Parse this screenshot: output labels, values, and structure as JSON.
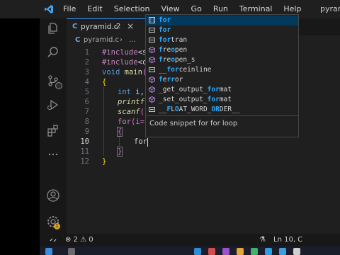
{
  "menu": [
    "File",
    "Edit",
    "Selection",
    "View",
    "Go",
    "Run",
    "Terminal",
    "Help"
  ],
  "window_title": "pyram",
  "tab": {
    "icon_letter": "C",
    "name": "pyramid.c",
    "problems": "2",
    "close": "×"
  },
  "breadcrumb": {
    "icon_letter": "C",
    "file": "pyramid.c",
    "separator": "›",
    "ellipsis": "..."
  },
  "editor": {
    "line_numbers": [
      "1",
      "2",
      "3",
      "4",
      "5",
      "6",
      "7",
      "8",
      "9",
      "10",
      "11",
      "12"
    ],
    "active_line": "10",
    "lines": {
      "l1_directive": "#include",
      "l1_rest": "<st",
      "l2_directive": "#include",
      "l2_rest": "<co",
      "l3_type": "void",
      "l3_name": "main",
      "l3_rest": "()",
      "l4": "{",
      "l5_type": "int",
      "l5_rest": "i,",
      "l6_fn": "printf",
      "l6_rest": "(",
      "l7_fn": "scanf",
      "l7_rest": "(\"",
      "l8_kw": "for",
      "l8_rest": "(i=1",
      "l9": "{",
      "l10_typed": "for",
      "l11": "}",
      "l12": "}"
    }
  },
  "suggestions": [
    {
      "match": "for",
      "rest": "",
      "icon": "snippet-icon",
      "selected": true
    },
    {
      "match": "for",
      "rest": "",
      "icon": "keyword-icon",
      "selected": false
    },
    {
      "match": "for",
      "rest": "tran",
      "icon": "keyword-icon",
      "selected": false
    },
    {
      "pre": "",
      "match": "f",
      "mid": "re",
      "match2": "o",
      "rest": "pen",
      "icon": "function-cube-icon"
    },
    {
      "pre": "",
      "match": "f",
      "mid": "re",
      "match2": "o",
      "rest": "pen_s",
      "icon": "function-cube-icon"
    },
    {
      "pre": "__",
      "match": "for",
      "rest": "ceinline",
      "icon": "keyword-icon"
    },
    {
      "pre": "",
      "match": "f",
      "mid": "e",
      "match2": "rr",
      "rest": "or",
      "icon": "function-cube-icon"
    },
    {
      "pre": "_get_output_",
      "match": "for",
      "rest": "mat",
      "icon": "function-cube-icon"
    },
    {
      "pre": "_set_output_",
      "match": "for",
      "rest": "mat",
      "icon": "function-cube-icon"
    },
    {
      "pre": "__",
      "match": "F",
      "mid": "L",
      "match2": "O",
      "rest": "AT_WORD_",
      "match3": "OR",
      "rest2": "DER__",
      "icon": "keyword-icon"
    }
  ],
  "suggest_detail": "Code snippet for for loop",
  "status": {
    "errors": "2",
    "warnings": "0",
    "position": "Ln 10, C"
  },
  "settings_badge": "1",
  "colors": {
    "accent": "#3794ff",
    "selection": "#04395e",
    "match": "#2aaaff"
  }
}
